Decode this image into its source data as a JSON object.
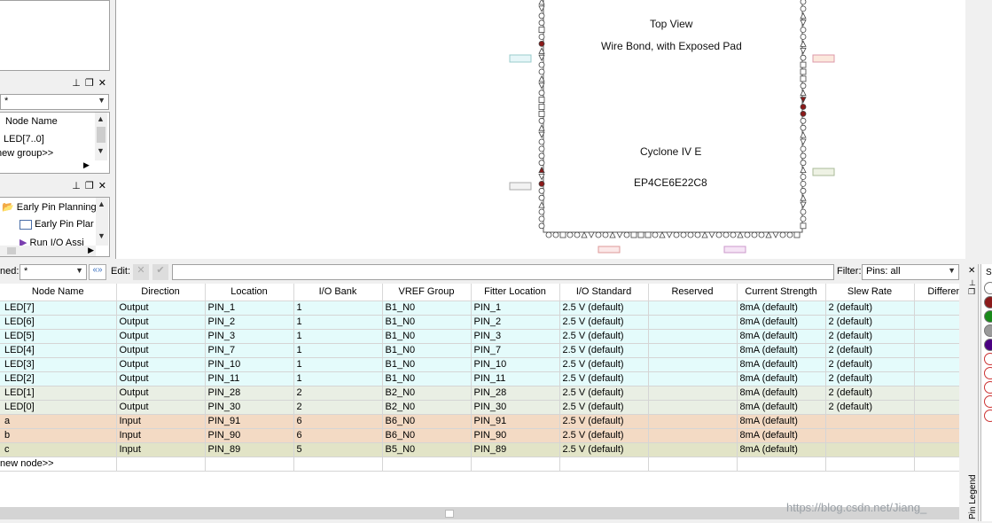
{
  "node_panel": {
    "filter_value": "*",
    "column_header": "Node Name",
    "items": [
      "LED[7..0]",
      "new group>>"
    ]
  },
  "tasks_panel": {
    "items": [
      "Early Pin Planning",
      "Early Pin Plar",
      "Run I/O Assi"
    ]
  },
  "chip_view": {
    "view_title": "Top View",
    "package_label": "Wire Bond, with Exposed Pad",
    "family": "Cyclone IV E",
    "device": "EP4CE6E22C8"
  },
  "toolbar": {
    "named_label": "ned:",
    "named_value": "*",
    "edit_label": "Edit:",
    "filter_label": "Filter:",
    "filter_value": "Pins: all"
  },
  "table": {
    "columns": [
      "Node Name",
      "Direction",
      "Location",
      "I/O Bank",
      "VREF Group",
      "Fitter Location",
      "I/O Standard",
      "Reserved",
      "Current Strength",
      "Slew Rate",
      "Differen"
    ],
    "rows": [
      {
        "name": "LED[7]",
        "direction": "Output",
        "location": "PIN_1",
        "bank": "1",
        "vref": "B1_N0",
        "fitter": "PIN_1",
        "standard": "2.5 V (default)",
        "reserved": "",
        "current": "8mA (default)",
        "slew": "2 (default)",
        "diff": "",
        "bank_color": "c1"
      },
      {
        "name": "LED[6]",
        "direction": "Output",
        "location": "PIN_2",
        "bank": "1",
        "vref": "B1_N0",
        "fitter": "PIN_2",
        "standard": "2.5 V (default)",
        "reserved": "",
        "current": "8mA (default)",
        "slew": "2 (default)",
        "diff": "",
        "bank_color": "c1"
      },
      {
        "name": "LED[5]",
        "direction": "Output",
        "location": "PIN_3",
        "bank": "1",
        "vref": "B1_N0",
        "fitter": "PIN_3",
        "standard": "2.5 V (default)",
        "reserved": "",
        "current": "8mA (default)",
        "slew": "2 (default)",
        "diff": "",
        "bank_color": "c1"
      },
      {
        "name": "LED[4]",
        "direction": "Output",
        "location": "PIN_7",
        "bank": "1",
        "vref": "B1_N0",
        "fitter": "PIN_7",
        "standard": "2.5 V (default)",
        "reserved": "",
        "current": "8mA (default)",
        "slew": "2 (default)",
        "diff": "",
        "bank_color": "c1"
      },
      {
        "name": "LED[3]",
        "direction": "Output",
        "location": "PIN_10",
        "bank": "1",
        "vref": "B1_N0",
        "fitter": "PIN_10",
        "standard": "2.5 V (default)",
        "reserved": "",
        "current": "8mA (default)",
        "slew": "2 (default)",
        "diff": "",
        "bank_color": "c1"
      },
      {
        "name": "LED[2]",
        "direction": "Output",
        "location": "PIN_11",
        "bank": "1",
        "vref": "B1_N0",
        "fitter": "PIN_11",
        "standard": "2.5 V (default)",
        "reserved": "",
        "current": "8mA (default)",
        "slew": "2 (default)",
        "diff": "",
        "bank_color": "c1"
      },
      {
        "name": "LED[1]",
        "direction": "Output",
        "location": "PIN_28",
        "bank": "2",
        "vref": "B2_N0",
        "fitter": "PIN_28",
        "standard": "2.5 V (default)",
        "reserved": "",
        "current": "8mA (default)",
        "slew": "2 (default)",
        "diff": "",
        "bank_color": "c2"
      },
      {
        "name": "LED[0]",
        "direction": "Output",
        "location": "PIN_30",
        "bank": "2",
        "vref": "B2_N0",
        "fitter": "PIN_30",
        "standard": "2.5 V (default)",
        "reserved": "",
        "current": "8mA (default)",
        "slew": "2 (default)",
        "diff": "",
        "bank_color": "c2"
      },
      {
        "name": "a",
        "direction": "Input",
        "location": "PIN_91",
        "bank": "6",
        "vref": "B6_N0",
        "fitter": "PIN_91",
        "standard": "2.5 V (default)",
        "reserved": "",
        "current": "8mA (default)",
        "slew": "",
        "diff": "",
        "bank_color": "c6"
      },
      {
        "name": "b",
        "direction": "Input",
        "location": "PIN_90",
        "bank": "6",
        "vref": "B6_N0",
        "fitter": "PIN_90",
        "standard": "2.5 V (default)",
        "reserved": "",
        "current": "8mA (default)",
        "slew": "",
        "diff": "",
        "bank_color": "c6"
      },
      {
        "name": "c",
        "direction": "Input",
        "location": "PIN_89",
        "bank": "5",
        "vref": "B5_N0",
        "fitter": "PIN_89",
        "standard": "2.5 V (default)",
        "reserved": "",
        "current": "8mA (default)",
        "slew": "",
        "diff": "",
        "bank_color": "c5"
      }
    ],
    "new_node_label": "new node>>"
  },
  "legend": {
    "tab_label": "Pin Legend",
    "header_char": "S",
    "dot_colors": [
      "#ffffff",
      "#8b1a1a",
      "#1a8a1a",
      "#9a9a9a",
      "#4b0082",
      "#ffffff",
      "#ffffff",
      "#ffffff",
      "#ffffff",
      "#ffffff"
    ]
  },
  "watermark": "https://blog.csdn.net/Jiang_"
}
